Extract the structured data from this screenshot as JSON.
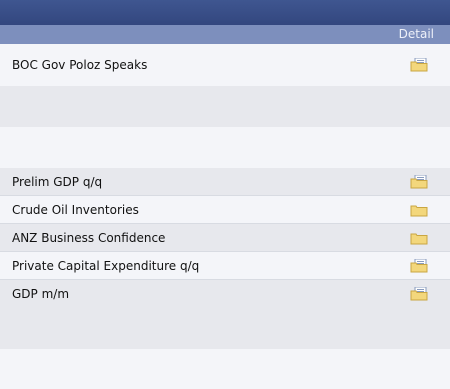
{
  "table": {
    "detail_header": "Detail",
    "rows": [
      {
        "label": "BOC Gov Poloz Speaks",
        "icon": "folder-page-icon"
      },
      {
        "label": "",
        "icon": ""
      },
      {
        "label": "",
        "icon": ""
      },
      {
        "label": "Prelim GDP q/q",
        "icon": "folder-page-icon"
      },
      {
        "label": "Crude Oil Inventories",
        "icon": "folder-icon"
      },
      {
        "label": "ANZ Business Confidence",
        "icon": "folder-icon"
      },
      {
        "label": "Private Capital Expenditure q/q",
        "icon": "folder-page-icon"
      },
      {
        "label": "GDP m/m",
        "icon": "folder-page-icon"
      },
      {
        "label": "",
        "icon": ""
      },
      {
        "label": "",
        "icon": ""
      }
    ]
  },
  "colors": {
    "topbar": "#3f5690",
    "header": "#7d8fbd",
    "row_light": "#f4f5f9",
    "row_gray": "#e7e8ed",
    "folder": "#f3d77c"
  }
}
